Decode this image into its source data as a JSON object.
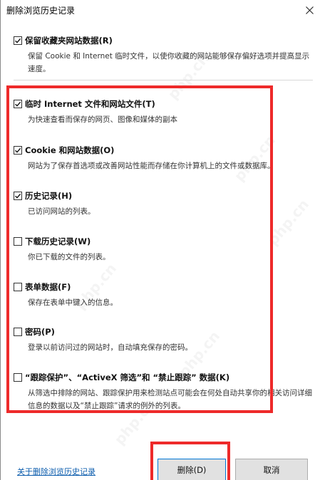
{
  "window": {
    "title": "删除浏览历史记录"
  },
  "options": [
    {
      "id": "favorites",
      "label": "保留收藏夹网站数据(R)",
      "checked": true,
      "description": "保留 Cookie 和 Internet 临时文件，以使你收藏的网站能够保存偏好选项并提高显示速度。"
    },
    {
      "id": "temp-files",
      "label": "临时 Internet 文件和网站文件(T)",
      "checked": true,
      "description": "为快速查看而保存的网页、图像和媒体的副本"
    },
    {
      "id": "cookies",
      "label": "Cookie 和网站数据(O)",
      "checked": true,
      "description": "网站为了保存首选项或改善网站性能而存储在你计算机上的文件或数据库。"
    },
    {
      "id": "history",
      "label": "历史记录(H)",
      "checked": true,
      "description": "已访问网站的列表。"
    },
    {
      "id": "download-history",
      "label": "下载历史记录(W)",
      "checked": false,
      "description": "你已下载的文件的列表。"
    },
    {
      "id": "form-data",
      "label": "表单数据(F)",
      "checked": false,
      "description": "保存在表单中键入的信息。"
    },
    {
      "id": "passwords",
      "label": "密码(P)",
      "checked": false,
      "description": "登录以前访问过的网站时，自动填充保存的密码。"
    },
    {
      "id": "tracking",
      "label": "“跟踪保护”、“ActiveX 筛选”和 “禁止跟踪” 数据(K)",
      "checked": false,
      "description": "从筛选中排除的网站、跟踪保护用来检测站点可能会在何处自动共享你的相关访问详细信息的数据以及“禁止跟踪”请求的例外的列表。"
    }
  ],
  "footer": {
    "about_link": "关于删除浏览历史记录",
    "delete_label": "删除(D)",
    "cancel_label": "取消"
  },
  "watermark_text": "php.cn",
  "colors": {
    "highlight": "#ee2a2a",
    "link": "#0b5cad",
    "button_face": "#e1e1e1",
    "focus_border": "#0078d7"
  }
}
